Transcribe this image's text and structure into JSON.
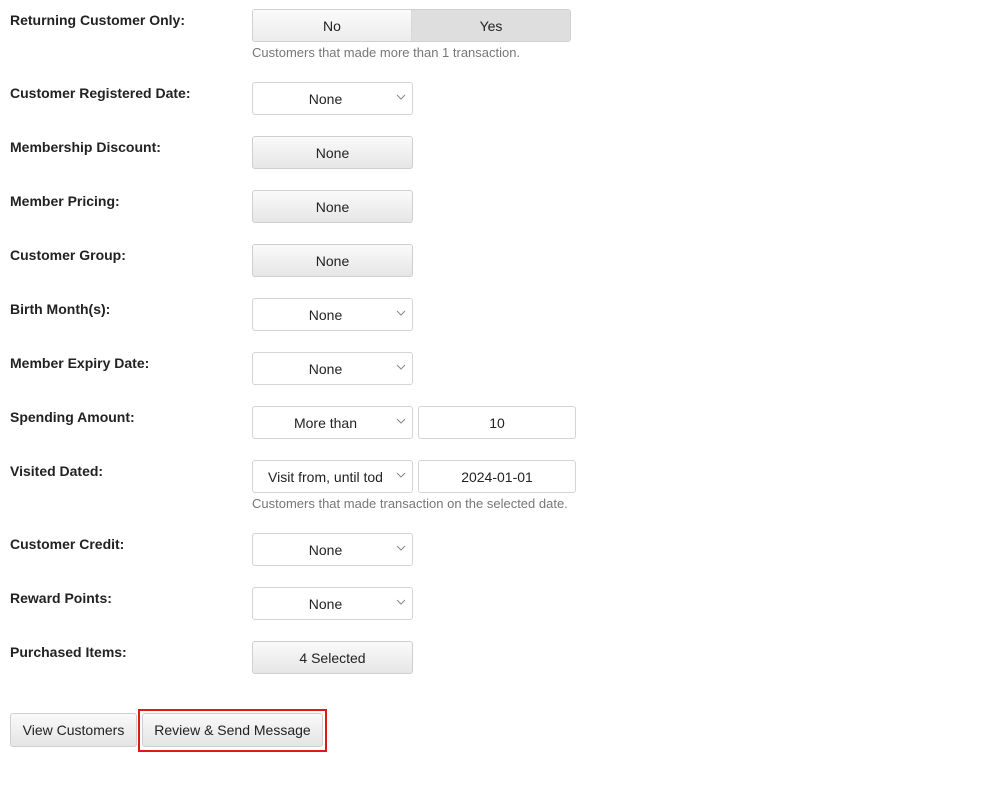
{
  "returning_customer": {
    "label": "Returning Customer Only:",
    "options": [
      "No",
      "Yes"
    ],
    "selected": "Yes",
    "help": "Customers that made more than 1 transaction."
  },
  "registered_date": {
    "label": "Customer Registered Date:",
    "value": "None"
  },
  "membership_discount": {
    "label": "Membership Discount:",
    "value": "None"
  },
  "member_pricing": {
    "label": "Member Pricing:",
    "value": "None"
  },
  "customer_group": {
    "label": "Customer Group:",
    "value": "None"
  },
  "birth_months": {
    "label": "Birth Month(s):",
    "value": "None"
  },
  "member_expiry": {
    "label": "Member Expiry Date:",
    "value": "None"
  },
  "spending_amount": {
    "label": "Spending Amount:",
    "value": "More than",
    "amount": "10"
  },
  "visited_dated": {
    "label": "Visited Dated:",
    "value": "Visit from, until tod",
    "date": "2024-01-01",
    "help": "Customers that made transaction on the selected date."
  },
  "customer_credit": {
    "label": "Customer Credit:",
    "value": "None"
  },
  "reward_points": {
    "label": "Reward Points:",
    "value": "None"
  },
  "purchased_items": {
    "label": "Purchased Items:",
    "value": "4 Selected"
  },
  "actions": {
    "view_customers": "View Customers",
    "review_send": "Review & Send Message"
  },
  "highlight_color": "#e01818"
}
